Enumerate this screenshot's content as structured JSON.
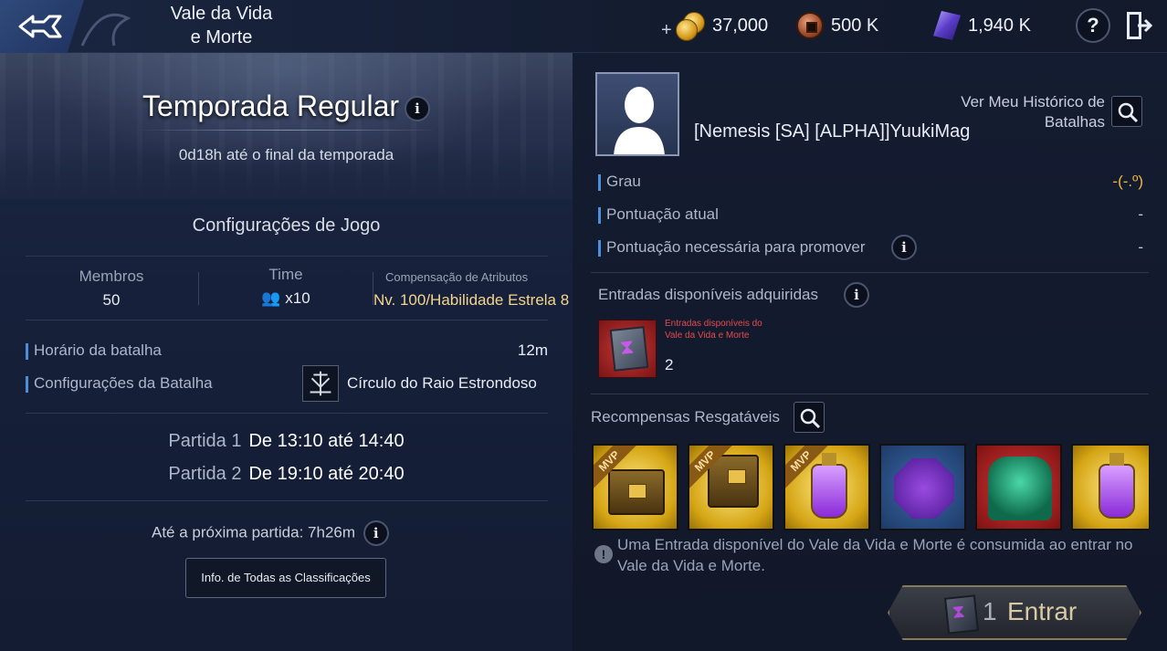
{
  "header": {
    "title_line1": "Vale da Vida",
    "title_line2": "e Morte",
    "plus": "+",
    "currencies": [
      {
        "name": "gold",
        "value": "37,000"
      },
      {
        "name": "bronze",
        "value": "500 K"
      },
      {
        "name": "crystal",
        "value": "1,940 K"
      }
    ],
    "help": "?"
  },
  "season": {
    "title": "Temporada Regular",
    "subtitle": "0d18h até o final da temporada"
  },
  "game_settings": {
    "title": "Configurações de Jogo",
    "members_label": "Membros",
    "members_value": "50",
    "time_label": "Time",
    "time_value": "x10",
    "attr_label": "Compensação de Atributos",
    "attr_value": "Nv. 100/Habilidade Estrela 8",
    "battle_time_label": "Horário da batalha",
    "battle_time_value": "12m",
    "battle_settings_label": "Configurações da Batalha",
    "battle_settings_value": "Círculo do Raio Estrondoso"
  },
  "matches": [
    {
      "label": "Partida 1",
      "value": "De 13:10 até 14:40"
    },
    {
      "label": "Partida 2",
      "value": "De 19:10 até 20:40"
    }
  ],
  "next_match": "Até a próxima partida: 7h26m",
  "all_ranks_button": "Info. de Todas as Classificações",
  "player": {
    "name": "[Nemesis [SA] [ALPHA]]YuukiMag",
    "history_label": "Ver Meu Histórico de Batalhas"
  },
  "stats": [
    {
      "label": "Grau",
      "value": "-(-.º)"
    },
    {
      "label": "Pontuação atual",
      "value": "-"
    },
    {
      "label": "Pontuação necessária para promover",
      "value": "-"
    }
  ],
  "entries": {
    "title": "Entradas disponíveis adquiridas",
    "item_desc": "Entradas disponíveis do Vale da Vida e Morte",
    "item_count": "2"
  },
  "rewards": {
    "title": "Recompensas Resgatáveis",
    "mvp_label": "MVP"
  },
  "notice": "Uma Entrada disponível do Vale da Vida e Morte é consumida ao entrar no Vale da Vida e Morte.",
  "enter_button": {
    "count": "1",
    "label": "Entrar"
  },
  "colors": {
    "accent_bar": "#4a8fd8",
    "gold_text": "#f3d58e",
    "entry_red": "#e44b4b"
  }
}
